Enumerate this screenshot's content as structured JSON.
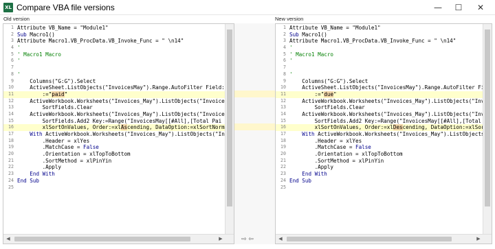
{
  "window": {
    "app_icon_text": "XL",
    "title": "Compare VBA file versions",
    "min_glyph": "—",
    "max_glyph": "☐",
    "close_glyph": "✕"
  },
  "colors": {
    "changed_line_bg": "#ffffcc",
    "changed_word_bg": "#f2d6a8",
    "keyword": "#00008b",
    "comment": "#007f00"
  },
  "old": {
    "label": "Old version",
    "lines": [
      {
        "n": "1",
        "t": "Attribute VB_Name = \"Module1\""
      },
      {
        "n": "2",
        "t": "Sub Macro1()"
      },
      {
        "n": "3",
        "t": "Attribute Macro1.VB_ProcData.VB_Invoke_Func = \" \\n14\""
      },
      {
        "n": "4",
        "t": "'"
      },
      {
        "n": "5",
        "t": "' Macro1 Macro"
      },
      {
        "n": "6",
        "t": "'"
      },
      {
        "n": "7",
        "t": ""
      },
      {
        "n": "8",
        "t": "'"
      },
      {
        "n": "9",
        "t": "    Columns(\"G:G\").Select"
      },
      {
        "n": "10",
        "t": "    ActiveSheet.ListObjects(\"InvoicesMay\").Range.AutoFilter Field:="
      },
      {
        "n": "11",
        "t": "        :=\"paid\""
      },
      {
        "n": "12",
        "t": "    ActiveWorkbook.Worksheets(\"Invoices_May\").ListObjects(\"Invoices"
      },
      {
        "n": "13",
        "t": "        SortFields.Clear"
      },
      {
        "n": "14",
        "t": "    ActiveWorkbook.Worksheets(\"Invoices_May\").ListObjects(\"Invoice"
      },
      {
        "n": "15",
        "t": "        SortFields.Add2 Key:=Range(\"InvoicesMay[[#All],[Total Pai"
      },
      {
        "n": "16",
        "t": "        xlSortOnValues, Order:=xlAscending, DataOption:=xlSortNorm"
      },
      {
        "n": "17",
        "t": "    With ActiveWorkbook.Worksheets(\"Invoices_May\").ListObjects(\"In"
      },
      {
        "n": "18",
        "t": "        .Header = xlYes"
      },
      {
        "n": "19",
        "t": "        .MatchCase = False"
      },
      {
        "n": "20",
        "t": "        .Orientation = xlTopToBottom"
      },
      {
        "n": "21",
        "t": "        .SortMethod = xlPinYin"
      },
      {
        "n": "22",
        "t": "        .Apply"
      },
      {
        "n": "23",
        "t": "    End With"
      },
      {
        "n": "24",
        "t": "End Sub"
      },
      {
        "n": "25",
        "t": ""
      }
    ]
  },
  "new": {
    "label": "New version",
    "lines": [
      {
        "n": "1",
        "t": "Attribute VB_Name = \"Module1\""
      },
      {
        "n": "2",
        "t": "Sub Macro1()"
      },
      {
        "n": "3",
        "t": "Attribute Macro1.VB_ProcData.VB_Invoke_Func = \" \\n14\""
      },
      {
        "n": "4",
        "t": "'"
      },
      {
        "n": "5",
        "t": "' Macro1 Macro"
      },
      {
        "n": "6",
        "t": "'"
      },
      {
        "n": "7",
        "t": ""
      },
      {
        "n": "8",
        "t": "'"
      },
      {
        "n": "9",
        "t": "    Columns(\"G:G\").Select"
      },
      {
        "n": "10",
        "t": "    ActiveSheet.ListObjects(\"InvoicesMay\").Range.AutoFilter Field"
      },
      {
        "n": "11",
        "t": "        :=\"due\""
      },
      {
        "n": "12",
        "t": "    ActiveWorkbook.Worksheets(\"Invoices_May\").ListObjects(\"Invoic"
      },
      {
        "n": "13",
        "t": "        SortFields.Clear"
      },
      {
        "n": "14",
        "t": "    ActiveWorkbook.Worksheets(\"Invoices_May\").ListObjects(\"Invoic"
      },
      {
        "n": "15",
        "t": "        SortFields.Add2 Key:=Range(\"InvoicesMay[[#All],[Total Paid"
      },
      {
        "n": "16",
        "t": "        xlSortOnValues, Order:=xlDescending, DataOption:=xlSortNo"
      },
      {
        "n": "17",
        "t": "    With ActiveWorkbook.Worksheets(\"Invoices_May\").ListObjects(\"I"
      },
      {
        "n": "18",
        "t": "        .Header = xlYes"
      },
      {
        "n": "19",
        "t": "        .MatchCase = False"
      },
      {
        "n": "20",
        "t": "        .Orientation = xlTopToBottom"
      },
      {
        "n": "21",
        "t": "        .SortMethod = xlPinYin"
      },
      {
        "n": "22",
        "t": "        .Apply"
      },
      {
        "n": "23",
        "t": "    End With"
      },
      {
        "n": "24",
        "t": "End Sub"
      },
      {
        "n": "25",
        "t": ""
      }
    ]
  },
  "diff": {
    "changed_lines": [
      11,
      16
    ],
    "old_words": {
      "11": "paid",
      "16": "As"
    },
    "new_words": {
      "11": "due",
      "16": "Des"
    }
  },
  "middle": {
    "copy_right_icon": "copy-to-right-icon",
    "copy_left_icon": "copy-to-left-icon",
    "copy_right_glyph": "⇨",
    "copy_left_glyph": "⇦"
  },
  "scroll": {
    "left_arrow": "◀",
    "right_arrow": "▶"
  }
}
